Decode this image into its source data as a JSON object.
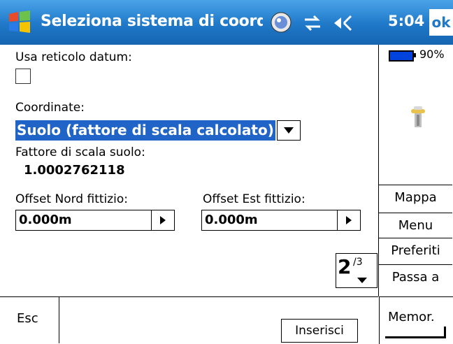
{
  "titlebar": {
    "title": "Seleziona sistema di coordina",
    "time": "5:04",
    "ok_label": "ok",
    "icons": [
      "windows-start-icon",
      "gps-status-icon",
      "connectivity-icon",
      "speaker-icon"
    ]
  },
  "form": {
    "datum_label": "Usa reticolo datum:",
    "datum_checked": false,
    "coordinates_label": "Coordinate:",
    "coordinates_value": "Suolo (fattore di scala calcolato)",
    "scale_label": "Fattore di scala suolo:",
    "scale_value": "1.0002762118",
    "offset_north_label": "Offset Nord fittizio:",
    "offset_north_value": "0.000m",
    "offset_east_label": "Offset Est fittizio:",
    "offset_east_value": "0.000m"
  },
  "pager": {
    "current": "2",
    "total": "/3"
  },
  "sidebar": {
    "battery": "90%",
    "battery_level": 0.9,
    "buttons": [
      "Mappa",
      "Menu",
      "Preferiti",
      "Passa a"
    ]
  },
  "bottom": {
    "esc_label": "Esc",
    "insert_label": "Inserisci",
    "store_label": "Memor."
  },
  "colors": {
    "titlebar": "#1f78c8",
    "selection": "#2064c8"
  }
}
